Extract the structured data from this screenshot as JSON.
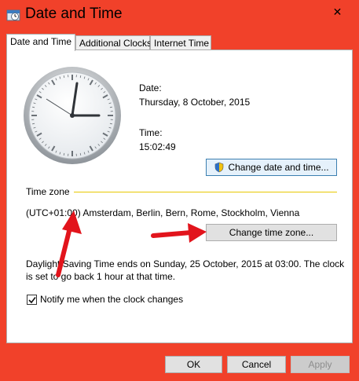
{
  "window": {
    "title": "Date and Time",
    "accent_color": "#f1412a",
    "close_glyph": "✕"
  },
  "tabs": [
    {
      "label": "Date and Time",
      "active": true
    },
    {
      "label": "Additional Clocks",
      "active": false
    },
    {
      "label": "Internet Time",
      "active": false
    }
  ],
  "date_time": {
    "date_label": "Date:",
    "date_value": "Thursday, 8 October, 2015",
    "time_label": "Time:",
    "time_value": "15:02:49",
    "change_button": "Change date and time..."
  },
  "time_zone": {
    "section_label": "Time zone",
    "value": "(UTC+01:00) Amsterdam, Berlin, Bern, Rome, Stockholm, Vienna",
    "change_button": "Change time zone..."
  },
  "dst": {
    "line1": "Daylight Saving Time ends on Sunday, 25 October, 2015 at 03:00. The clock",
    "line2": "is set to go back 1 hour at that time."
  },
  "notify": {
    "label": "Notify me when the clock changes",
    "checked": true
  },
  "footer": {
    "ok": "OK",
    "cancel": "Cancel",
    "apply": "Apply"
  }
}
